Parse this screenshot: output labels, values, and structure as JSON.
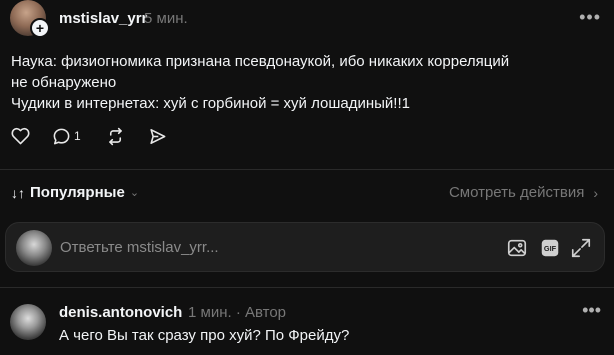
{
  "post": {
    "username": "mstislav_yrr",
    "time": "5 мин.",
    "lines": [
      "Наука: физиогномика признана псевдонаукой, ибо никаких корреляций",
      "не обнаружено",
      "Чудики в интернетах: хуй с горбиной = хуй лошадиный!!1"
    ],
    "reply_count": "1",
    "more_icon": "•••"
  },
  "sort": {
    "label": "Популярные",
    "icon": "↓↑",
    "chevron": "⌄"
  },
  "activity_link": {
    "label": "Смотреть действия",
    "chevron": "›"
  },
  "composer": {
    "placeholder": "Ответьте mstislav_yrr..."
  },
  "reply": {
    "username": "denis.antonovich",
    "meta": "1 мин. · Автор",
    "text": "А чего Вы так сразу про хуй? По Фрейду?",
    "more_icon": "•••"
  },
  "icons": {
    "like": "heart-icon",
    "reply": "comment-icon",
    "repost": "repost-icon",
    "share": "share-icon",
    "image": "image-icon",
    "gif": "gif-icon",
    "expand": "expand-icon"
  }
}
